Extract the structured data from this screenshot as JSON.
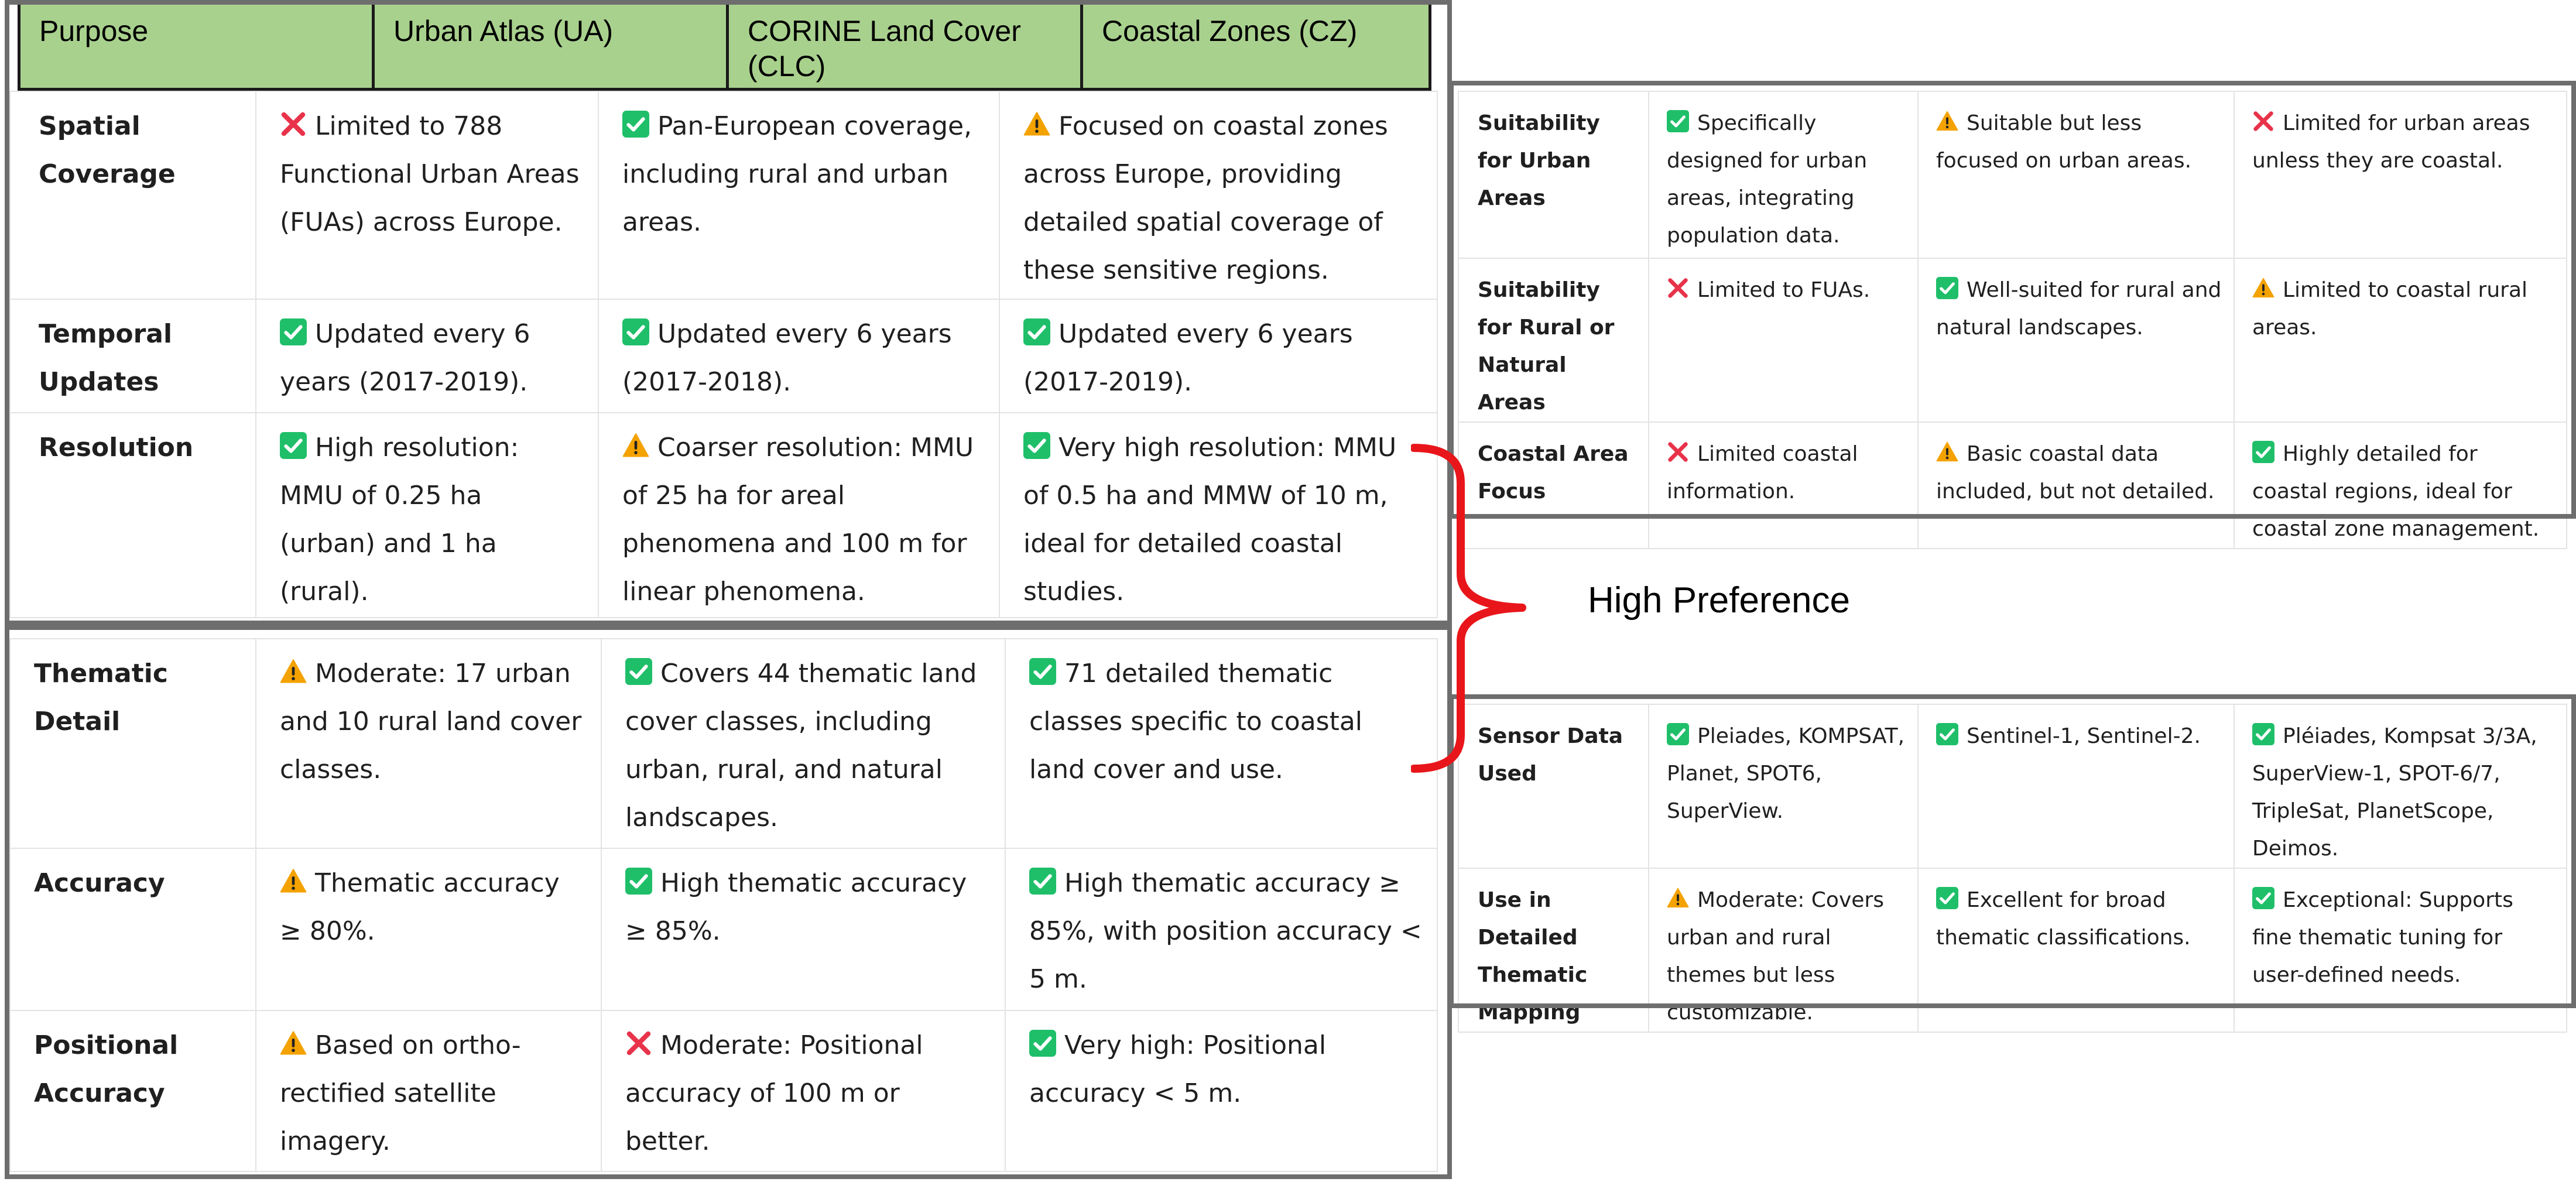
{
  "header": {
    "columns": [
      "Purpose",
      "Urban Atlas (UA)",
      "CORINE Land Cover (CLC)",
      "Coastal Zones (CZ)"
    ]
  },
  "colors": {
    "header_bg": "#a9d18e",
    "frame": "#6e6e6e",
    "brace": "#e8161b",
    "check": "#1fbf6a",
    "cross": "#e8334a",
    "warning": "#f4a200"
  },
  "left_top_rows": [
    {
      "label": "Spatial Coverage",
      "cells": [
        {
          "icon": "cross-icon",
          "text": "Limited to 788 Functional Urban Areas (FUAs) across Europe."
        },
        {
          "icon": "check-icon",
          "text": "Pan-European coverage, including rural and urban areas."
        },
        {
          "icon": "warning-icon",
          "text": "Focused on coastal zones across Europe, providing detailed spatial coverage of these sensitive regions."
        }
      ]
    },
    {
      "label": "Temporal Updates",
      "cells": [
        {
          "icon": "check-icon",
          "text": "Updated every 6 years (2017-2019)."
        },
        {
          "icon": "check-icon",
          "text": "Updated every 6 years (2017-2018)."
        },
        {
          "icon": "check-icon",
          "text": "Updated every 6 years (2017-2019)."
        }
      ]
    },
    {
      "label": "Resolution",
      "cells": [
        {
          "icon": "check-icon",
          "text": "High resolution: MMU of 0.25 ha (urban) and 1 ha (rural)."
        },
        {
          "icon": "warning-icon",
          "text": "Coarser resolution: MMU of 25 ha for areal phenomena and 100 m for linear phenomena."
        },
        {
          "icon": "check-icon",
          "text": "Very high resolution: MMU of 0.5 ha and MMW of 10 m, ideal for detailed coastal studies."
        }
      ]
    }
  ],
  "left_bottom_rows": [
    {
      "label": "Thematic Detail",
      "cells": [
        {
          "icon": "warning-icon",
          "text": "Moderate: 17 urban and 10 rural land cover classes."
        },
        {
          "icon": "check-icon",
          "text": "Covers 44 thematic land cover classes, including urban, rural, and natural landscapes."
        },
        {
          "icon": "check-icon",
          "text": "71 detailed thematic classes specific to coastal land cover and use."
        }
      ]
    },
    {
      "label": "Accuracy",
      "cells": [
        {
          "icon": "warning-icon",
          "text": "Thematic accuracy ≥ 80%."
        },
        {
          "icon": "check-icon",
          "text": "High thematic accuracy ≥ 85%."
        },
        {
          "icon": "check-icon",
          "text": "High thematic accuracy ≥ 85%, with position accuracy < 5 m."
        }
      ]
    },
    {
      "label": "Positional Accuracy",
      "cells": [
        {
          "icon": "warning-icon",
          "text": "Based on ortho-rectified satellite imagery."
        },
        {
          "icon": "cross-icon",
          "text": "Moderate: Positional accuracy of 100 m or better."
        },
        {
          "icon": "check-icon",
          "text": "Very high: Positional accuracy < 5 m."
        }
      ]
    }
  ],
  "right_top_rows": [
    {
      "label": "Suitability for Urban Areas",
      "cells": [
        {
          "icon": "check-icon",
          "text": "Specifically designed for urban areas, integrating population data."
        },
        {
          "icon": "warning-icon",
          "text": "Suitable but less focused on urban areas."
        },
        {
          "icon": "cross-icon",
          "text": "Limited for urban areas unless they are coastal."
        }
      ]
    },
    {
      "label": "Suitability for Rural or Natural Areas",
      "cells": [
        {
          "icon": "cross-icon",
          "text": "Limited to FUAs."
        },
        {
          "icon": "check-icon",
          "text": "Well-suited for rural and natural landscapes."
        },
        {
          "icon": "warning-icon",
          "text": "Limited to coastal rural areas."
        }
      ]
    },
    {
      "label": "Coastal Area Focus",
      "cells": [
        {
          "icon": "cross-icon",
          "text": "Limited coastal information."
        },
        {
          "icon": "warning-icon",
          "text": "Basic coastal data included, but not detailed."
        },
        {
          "icon": "check-icon",
          "text": "Highly detailed for coastal regions, ideal for coastal zone management."
        }
      ]
    }
  ],
  "right_bottom_rows": [
    {
      "label": "Sensor Data Used",
      "cells": [
        {
          "icon": "check-icon",
          "text": "Pleiades, KOMPSAT, Planet, SPOT6, SuperView."
        },
        {
          "icon": "check-icon",
          "text": "Sentinel-1, Sentinel-2."
        },
        {
          "icon": "check-icon",
          "text": "Pléiades, Kompsat 3/3A, SuperView-1, SPOT-6/7, TripleSat, PlanetScope, Deimos."
        }
      ]
    },
    {
      "label": "Use in Detailed Thematic Mapping",
      "cells": [
        {
          "icon": "warning-icon",
          "text": "Moderate: Covers urban and rural themes but less customizable."
        },
        {
          "icon": "check-icon",
          "text": "Excellent for broad thematic classifications."
        },
        {
          "icon": "check-icon",
          "text": "Exceptional: Supports fine thematic tuning for user-defined needs."
        }
      ]
    }
  ],
  "annotation": {
    "label": "High Preference"
  }
}
